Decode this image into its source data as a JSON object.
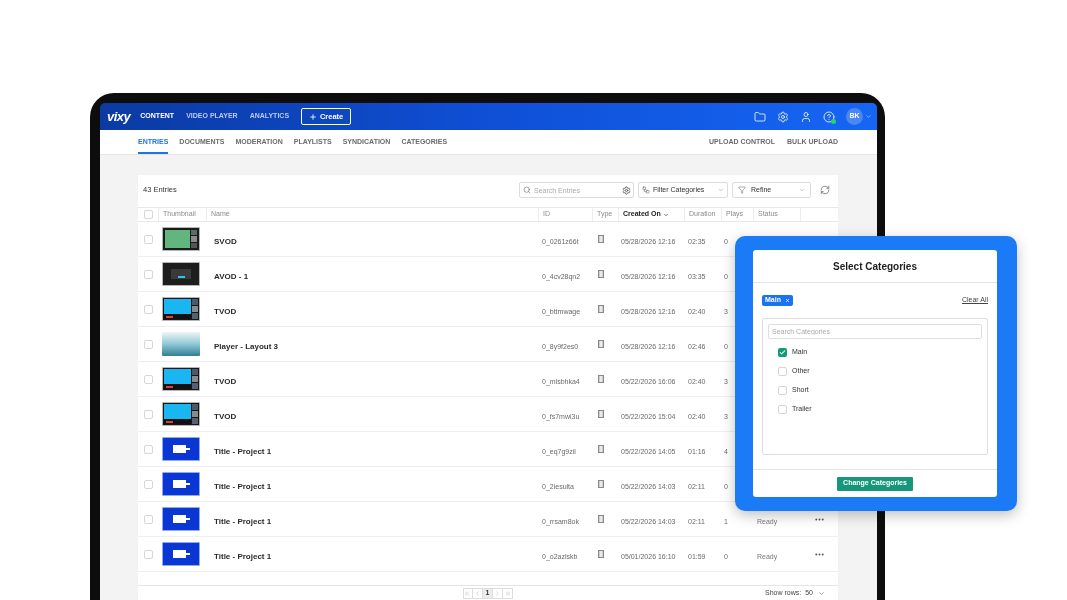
{
  "navbar": {
    "logo": "vixy",
    "items": [
      {
        "label": "CONTENT",
        "selected": true
      },
      {
        "label": "VIDEO PLAYER",
        "selected": false
      },
      {
        "label": "ANALYTICS",
        "selected": false
      }
    ],
    "create_button": "Create",
    "avatar_initials": "BK"
  },
  "subnav": {
    "tabs": [
      {
        "label": "ENTRIES",
        "selected": true
      },
      {
        "label": "DOCUMENTS",
        "selected": false
      },
      {
        "label": "MODERATION",
        "selected": false
      },
      {
        "label": "PLAYLISTS",
        "selected": false
      },
      {
        "label": "SYNDICATION",
        "selected": false
      },
      {
        "label": "CATEGORIES",
        "selected": false
      }
    ],
    "actions": [
      "UPLOAD CONTROL",
      "BULK UPLOAD"
    ]
  },
  "entries": {
    "count": "43 Entries",
    "search": {
      "placeholder": "Search Entries"
    },
    "filter_button": "Filter Categories",
    "refine_button": "Refine",
    "select_all": {
      "checked": false
    },
    "columns": [
      {
        "label": "Thumbnail",
        "sorted": false
      },
      {
        "label": "Name",
        "sorted": false
      },
      {
        "label": "ID",
        "sorted": false
      },
      {
        "label": "Type",
        "sorted": false
      },
      {
        "label": "Created On",
        "sorted": true
      },
      {
        "label": "Duration",
        "sorted": false
      },
      {
        "label": "Plays",
        "sorted": false
      },
      {
        "label": "Status",
        "sorted": false
      }
    ],
    "rows": [
      {
        "checked": false,
        "thumbnail": {
          "kind": "sports"
        },
        "name": "SVOD",
        "id": "0_0261z66t",
        "created_on": "05/28/2026 12:16",
        "duration": "02:35",
        "plays": "0"
      },
      {
        "checked": false,
        "thumbnail": {
          "kind": "dark"
        },
        "name": "AVOD - 1",
        "id": "0_4cv28qn2",
        "created_on": "05/28/2026 12:16",
        "duration": "03:35",
        "plays": "0"
      },
      {
        "checked": false,
        "thumbnail": {
          "kind": "bright"
        },
        "name": "TVOD",
        "id": "0_bttmwage",
        "created_on": "05/28/2026 12:16",
        "duration": "02:40",
        "plays": "3"
      },
      {
        "checked": false,
        "thumbnail": {
          "kind": "seascape"
        },
        "name": "Player - Layout 3",
        "id": "0_8y9f2es0",
        "created_on": "05/28/2026 12:16",
        "duration": "02:46",
        "plays": "0"
      },
      {
        "checked": false,
        "thumbnail": {
          "kind": "bright"
        },
        "name": "TVOD",
        "id": "0_mlsbhka4",
        "created_on": "05/22/2026 16:06",
        "duration": "02:40",
        "plays": "3"
      },
      {
        "checked": false,
        "thumbnail": {
          "kind": "bright"
        },
        "name": "TVOD",
        "id": "0_fs7mwi3u",
        "created_on": "05/22/2026 15:04",
        "duration": "02:40",
        "plays": "3"
      },
      {
        "checked": false,
        "thumbnail": {
          "kind": "title"
        },
        "name": "Title - Project 1",
        "id": "0_eq7g9zil",
        "created_on": "05/22/2026 14:05",
        "duration": "01:16",
        "plays": "4"
      },
      {
        "checked": false,
        "thumbnail": {
          "kind": "title"
        },
        "name": "Title - Project 1",
        "id": "0_2iesulta",
        "created_on": "05/22/2026 14:03",
        "duration": "02:11",
        "plays": "0"
      },
      {
        "checked": false,
        "thumbnail": {
          "kind": "title"
        },
        "name": "Title - Project 1",
        "id": "0_rrsam8ok",
        "created_on": "05/22/2026 14:03",
        "duration": "02:11",
        "plays": "1",
        "status": "Ready"
      },
      {
        "checked": false,
        "thumbnail": {
          "kind": "title"
        },
        "name": "Title - Project 1",
        "id": "0_o2azlskb",
        "created_on": "05/01/2026 16:10",
        "duration": "01:59",
        "plays": "0",
        "status": "Ready"
      }
    ],
    "pagination": {
      "pages": [
        {
          "label": "1",
          "selected": true
        }
      ],
      "show_rows_label": "Show rows:",
      "show_rows_value": "50"
    }
  },
  "dialog": {
    "title": "Select Categories",
    "chips": [
      {
        "label": "Main"
      }
    ],
    "clear_all": "Clear All",
    "search": {
      "placeholder": "Search Categories"
    },
    "options": [
      {
        "label": "Main",
        "checked": true
      },
      {
        "label": "Other",
        "checked": false
      },
      {
        "label": "Short",
        "checked": false
      },
      {
        "label": "Trailer",
        "checked": false
      }
    ],
    "submit_button": "Change Categories"
  }
}
